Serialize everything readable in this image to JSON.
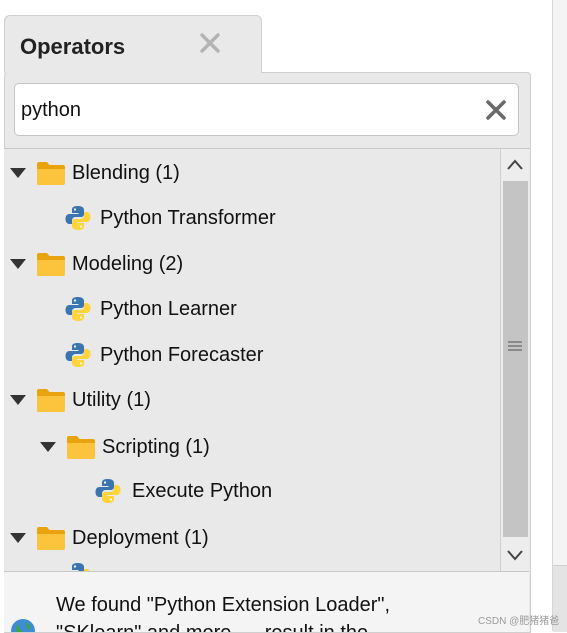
{
  "panel": {
    "tab_title": "Operators"
  },
  "search": {
    "value": "python",
    "placeholder": ""
  },
  "tree": {
    "blending": {
      "label": "Blending (1)"
    },
    "python_transformer": {
      "label": "Python Transformer"
    },
    "modeling": {
      "label": "Modeling (2)"
    },
    "python_learner": {
      "label": "Python Learner"
    },
    "python_forecaster": {
      "label": "Python Forecaster"
    },
    "utility": {
      "label": "Utility (1)"
    },
    "scripting": {
      "label": "Scripting (1)"
    },
    "execute_python": {
      "label": "Execute Python",
      "selected": true
    },
    "deployment": {
      "label": "Deployment (1)"
    }
  },
  "footer": {
    "line1": "We found \"Python Extension Loader\",",
    "line2": "\"SKlearn\" and more. ... result in the..."
  },
  "watermark": "CSDN @肥猪猪爸",
  "colors": {
    "selection": "#b9dbfb",
    "folder": "#f5b622",
    "python_blue": "#3a75b0",
    "python_yellow": "#ffd43b"
  }
}
